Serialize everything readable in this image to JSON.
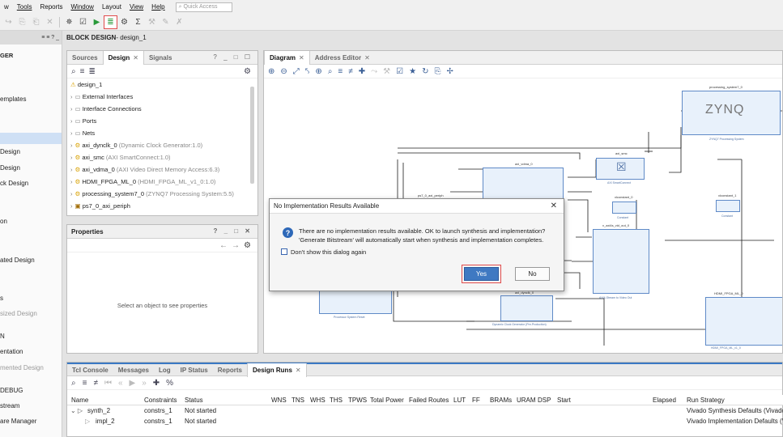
{
  "menu": {
    "items": [
      "w",
      "Tools",
      "Reports",
      "Window",
      "Layout",
      "View",
      "Help"
    ],
    "quick_access_placeholder": "Quick Access"
  },
  "flow_nav": {
    "header_controls": "≡ ≡ ? _",
    "items": [
      {
        "label": "GER",
        "style": "bold"
      },
      {
        "label": "emplates",
        "style": "normal"
      },
      {
        "label": "Design",
        "style": "normal"
      },
      {
        "label": "Design",
        "style": "normal"
      },
      {
        "label": "ck Design",
        "style": "normal"
      },
      {
        "label": "on",
        "style": "normal"
      },
      {
        "label": "ated Design",
        "style": "normal"
      },
      {
        "label": "s",
        "style": "normal"
      },
      {
        "label": "sized Design",
        "style": "dim"
      },
      {
        "label": "N",
        "style": "normal"
      },
      {
        "label": "entation",
        "style": "normal"
      },
      {
        "label": "mented Design",
        "style": "dim"
      },
      {
        "label": "DEBUG",
        "style": "normal"
      },
      {
        "label": "stream",
        "style": "normal"
      },
      {
        "label": "are Manager",
        "style": "normal"
      }
    ]
  },
  "block_design": {
    "title_prefix": "BLOCK DESIGN",
    "title_name": " - design_1"
  },
  "sources_panel": {
    "tabs": [
      "Sources",
      "Design",
      "Signals"
    ],
    "win_controls": "? _ □ ☐",
    "tree": [
      {
        "label": "design_1",
        "extra": "",
        "icon": "⚠"
      },
      {
        "label": "External Interfaces",
        "extra": "",
        "icon": "▭"
      },
      {
        "label": "Interface Connections",
        "extra": "",
        "icon": "▭"
      },
      {
        "label": "Ports",
        "extra": "",
        "icon": "▭"
      },
      {
        "label": "Nets",
        "extra": "",
        "icon": "▭"
      },
      {
        "label": "axi_dynclk_0",
        "extra": " (Dynamic Clock Generator:1.0)",
        "icon": "⚙"
      },
      {
        "label": "axi_smc",
        "extra": " (AXI SmartConnect:1.0)",
        "icon": "⚙"
      },
      {
        "label": "axi_vdma_0",
        "extra": " (AXI Video Direct Memory Access:6.3)",
        "icon": "⚙"
      },
      {
        "label": "HDMI_FPGA_ML_0",
        "extra": " (HDMI_FPGA_ML_v1_0:1.0)",
        "icon": "⚙"
      },
      {
        "label": "processing_system7_0",
        "extra": " (ZYNQ7 Processing System:5.5)",
        "icon": "⚙"
      },
      {
        "label": "ps7_0_axi_periph",
        "extra": "",
        "icon": "▣"
      }
    ]
  },
  "properties_panel": {
    "title": "Properties",
    "win_controls": "? _ □ ✕",
    "empty_message": "Select an object to see properties"
  },
  "diagram_panel": {
    "tabs": [
      "Diagram",
      "Address Editor"
    ],
    "blocks": [
      {
        "name": "processing_system7_0",
        "sub": "ZYNQ7 Processing System",
        "logo": "ZYNQ"
      },
      {
        "name": "axi_smc",
        "sub": "AXI SmartConnect"
      },
      {
        "name": "axi_vdma_0",
        "sub": ""
      },
      {
        "name": "ps7_0_axi_periph",
        "sub": ""
      },
      {
        "name": "xlconstant_0",
        "sub": "Constant"
      },
      {
        "name": "xlconstant_1",
        "sub": "Constant"
      },
      {
        "name": "v_axi4s_vid_out_0",
        "sub": "AXI4-Stream to Video Out"
      },
      {
        "name": "axi_dynclk_0",
        "sub": "Dynamic Clock Generator (Pre-Production)"
      },
      {
        "name": "",
        "sub": "Processor System Reset"
      },
      {
        "name": "HDMI_FPGA_ML_0",
        "sub": "HDMI_FPGA_ML_v1_0"
      }
    ]
  },
  "bottom_panel": {
    "tabs": [
      "Tcl Console",
      "Messages",
      "Log",
      "IP Status",
      "Reports",
      "Design Runs"
    ],
    "columns": [
      "Name",
      "Constraints",
      "Status",
      "WNS",
      "TNS",
      "WHS",
      "THS",
      "TPWS",
      "Total Power",
      "Failed Routes",
      "LUT",
      "FF",
      "BRAMs",
      "URAM",
      "DSP",
      "Start",
      "Elapsed",
      "Run Strategy"
    ],
    "rows": [
      {
        "name": "synth_2",
        "constraints": "constrs_1",
        "status": "Not started",
        "strategy": "Vivado Synthesis Defaults (Vivado S"
      },
      {
        "name": "impl_2",
        "constraints": "constrs_1",
        "status": "Not started",
        "strategy": "Vivado Implementation Defaults (Viv"
      }
    ]
  },
  "dialog": {
    "title": "No Implementation Results Available",
    "message_line1": "There are no implementation results available. OK to launch synthesis and implementation?",
    "message_line2": "'Generate Bitstream' will automatically start when synthesis and implementation completes.",
    "checkbox_label": "Don't show this dialog again",
    "yes_label": "Yes",
    "no_label": "No"
  }
}
